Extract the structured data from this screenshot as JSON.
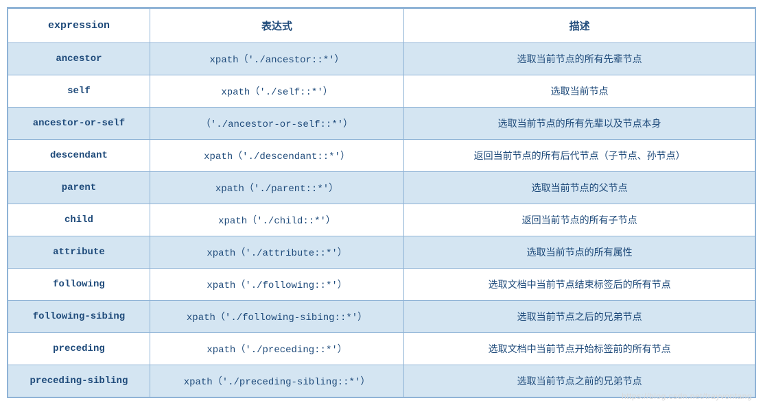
{
  "headers": {
    "col1": "expression",
    "col2": "表达式",
    "col3": "描述"
  },
  "rows": [
    {
      "expression": "ancestor",
      "syntax": "xpath（'./ancestor::*'）",
      "description": "选取当前节点的所有先辈节点"
    },
    {
      "expression": "self",
      "syntax": "xpath（'./self::*'）",
      "description": "选取当前节点"
    },
    {
      "expression": "ancestor-or-self",
      "syntax": "（'./ancestor-or-self::*'）",
      "description": "选取当前节点的所有先辈以及节点本身"
    },
    {
      "expression": "descendant",
      "syntax": "xpath（'./descendant::*'）",
      "description": "返回当前节点的所有后代节点（子节点、孙节点）"
    },
    {
      "expression": "parent",
      "syntax": "xpath（'./parent::*'）",
      "description": "选取当前节点的父节点"
    },
    {
      "expression": "child",
      "syntax": "xpath（'./child::*'）",
      "description": "返回当前节点的所有子节点"
    },
    {
      "expression": "attribute",
      "syntax": "xpath（'./attribute::*'）",
      "description": "选取当前节点的所有属性"
    },
    {
      "expression": "following",
      "syntax": "xpath（'./following::*'）",
      "description": "选取文档中当前节点结束标签后的所有节点"
    },
    {
      "expression": "following-sibing",
      "syntax": "xpath（'./following-sibing::*'）",
      "description": "选取当前节点之后的兄弟节点"
    },
    {
      "expression": "preceding",
      "syntax": "xpath（'./preceding::*'）",
      "description": "选取文档中当前节点开始标签前的所有节点"
    },
    {
      "expression": "preceding-sibling",
      "syntax": "xpath（'./preceding-sibling::*'）",
      "description": "选取当前节点之前的兄弟节点"
    }
  ],
  "watermark": "https://blog.csdn.net/trayvontang"
}
